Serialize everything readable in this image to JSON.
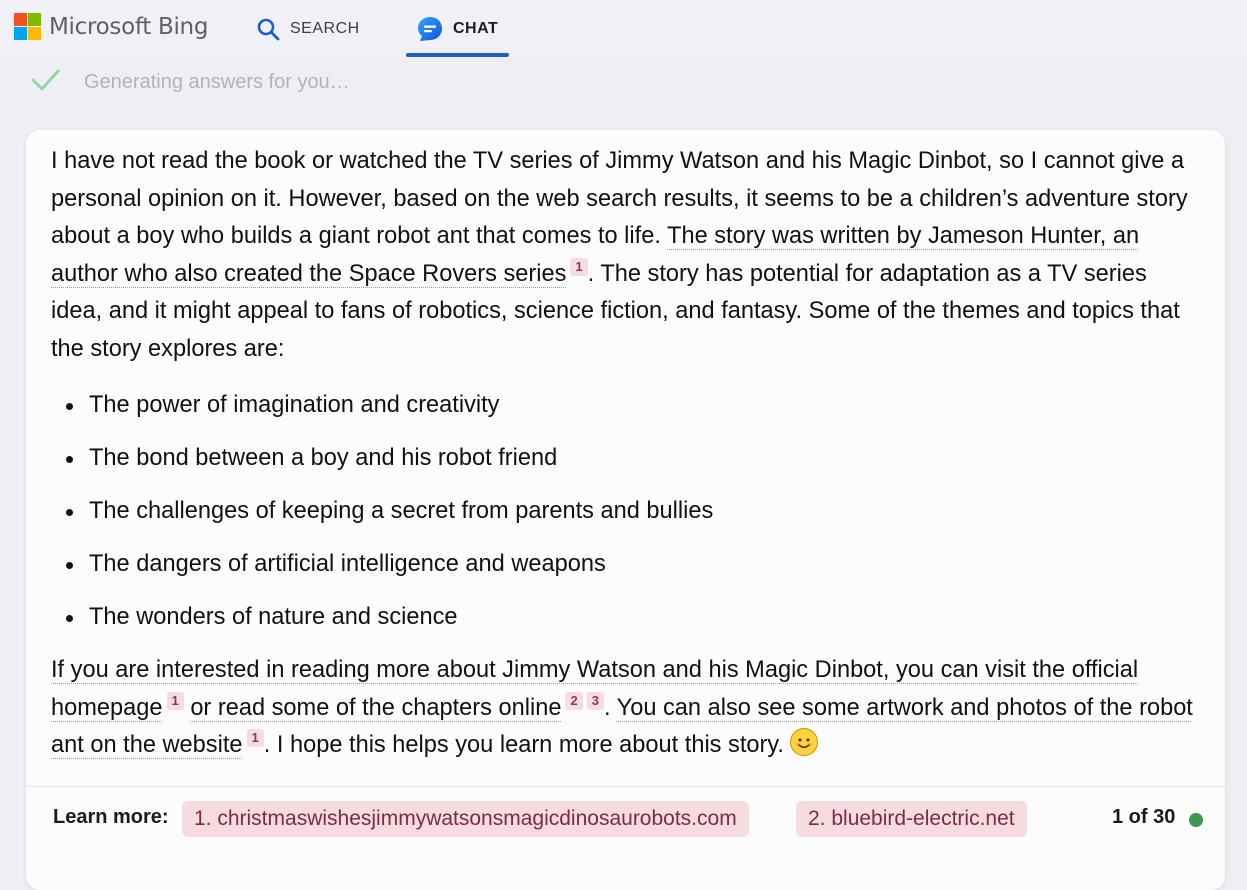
{
  "header": {
    "brand": "Microsoft Bing",
    "tabs": [
      {
        "label": "SEARCH",
        "icon": "search-icon",
        "active": false
      },
      {
        "label": "CHAT",
        "icon": "chat-icon",
        "active": true
      }
    ],
    "accent_color": "#1a5fcf"
  },
  "status": {
    "text": "Generating answers for you…",
    "icon": "checkmark-icon"
  },
  "answer": {
    "intro_parts": [
      "I have not read the book or watched the TV series of Jimmy Watson and his Magic Dinbot, so I cannot give a personal opinion on it. However, based on the web search results, it seems to be a children’s adventure story about a boy who builds a giant robot ant that comes to life. ",
      "The story was written by Jameson Hunter, an author who also created the Space Rovers series",
      "1",
      ". The story has potential for adaptation as a TV series idea, and it might appeal to fans of robotics, science fiction, and fantasy. Some of the themes and topics that the story explores are:"
    ],
    "themes": [
      "The power of imagination and creativity",
      "The bond between a boy and his robot friend",
      "The challenges of keeping a secret from parents and bullies",
      "The dangers of artificial intelligence and weapons",
      "The wonders of nature and science"
    ],
    "outro_parts": [
      "If you are interested in reading more about Jimmy Watson and his Magic Dinbot, you can visit the official homepage",
      "1",
      "or read some of the chapters online",
      "2",
      "3",
      ". ",
      "You can also see some artwork and photos of the robot ant on the website",
      "1",
      ". I hope this helps you learn more about this story."
    ],
    "emoji": "smile-emoji"
  },
  "footer": {
    "learn_more_label": "Learn more:",
    "sources": [
      "1. christmaswishesjimmywatsonsmagicdinosaurobots.com",
      "2. bluebird-electric.net"
    ],
    "page_count": "1 of 30",
    "status_color": "#3a9a55"
  }
}
